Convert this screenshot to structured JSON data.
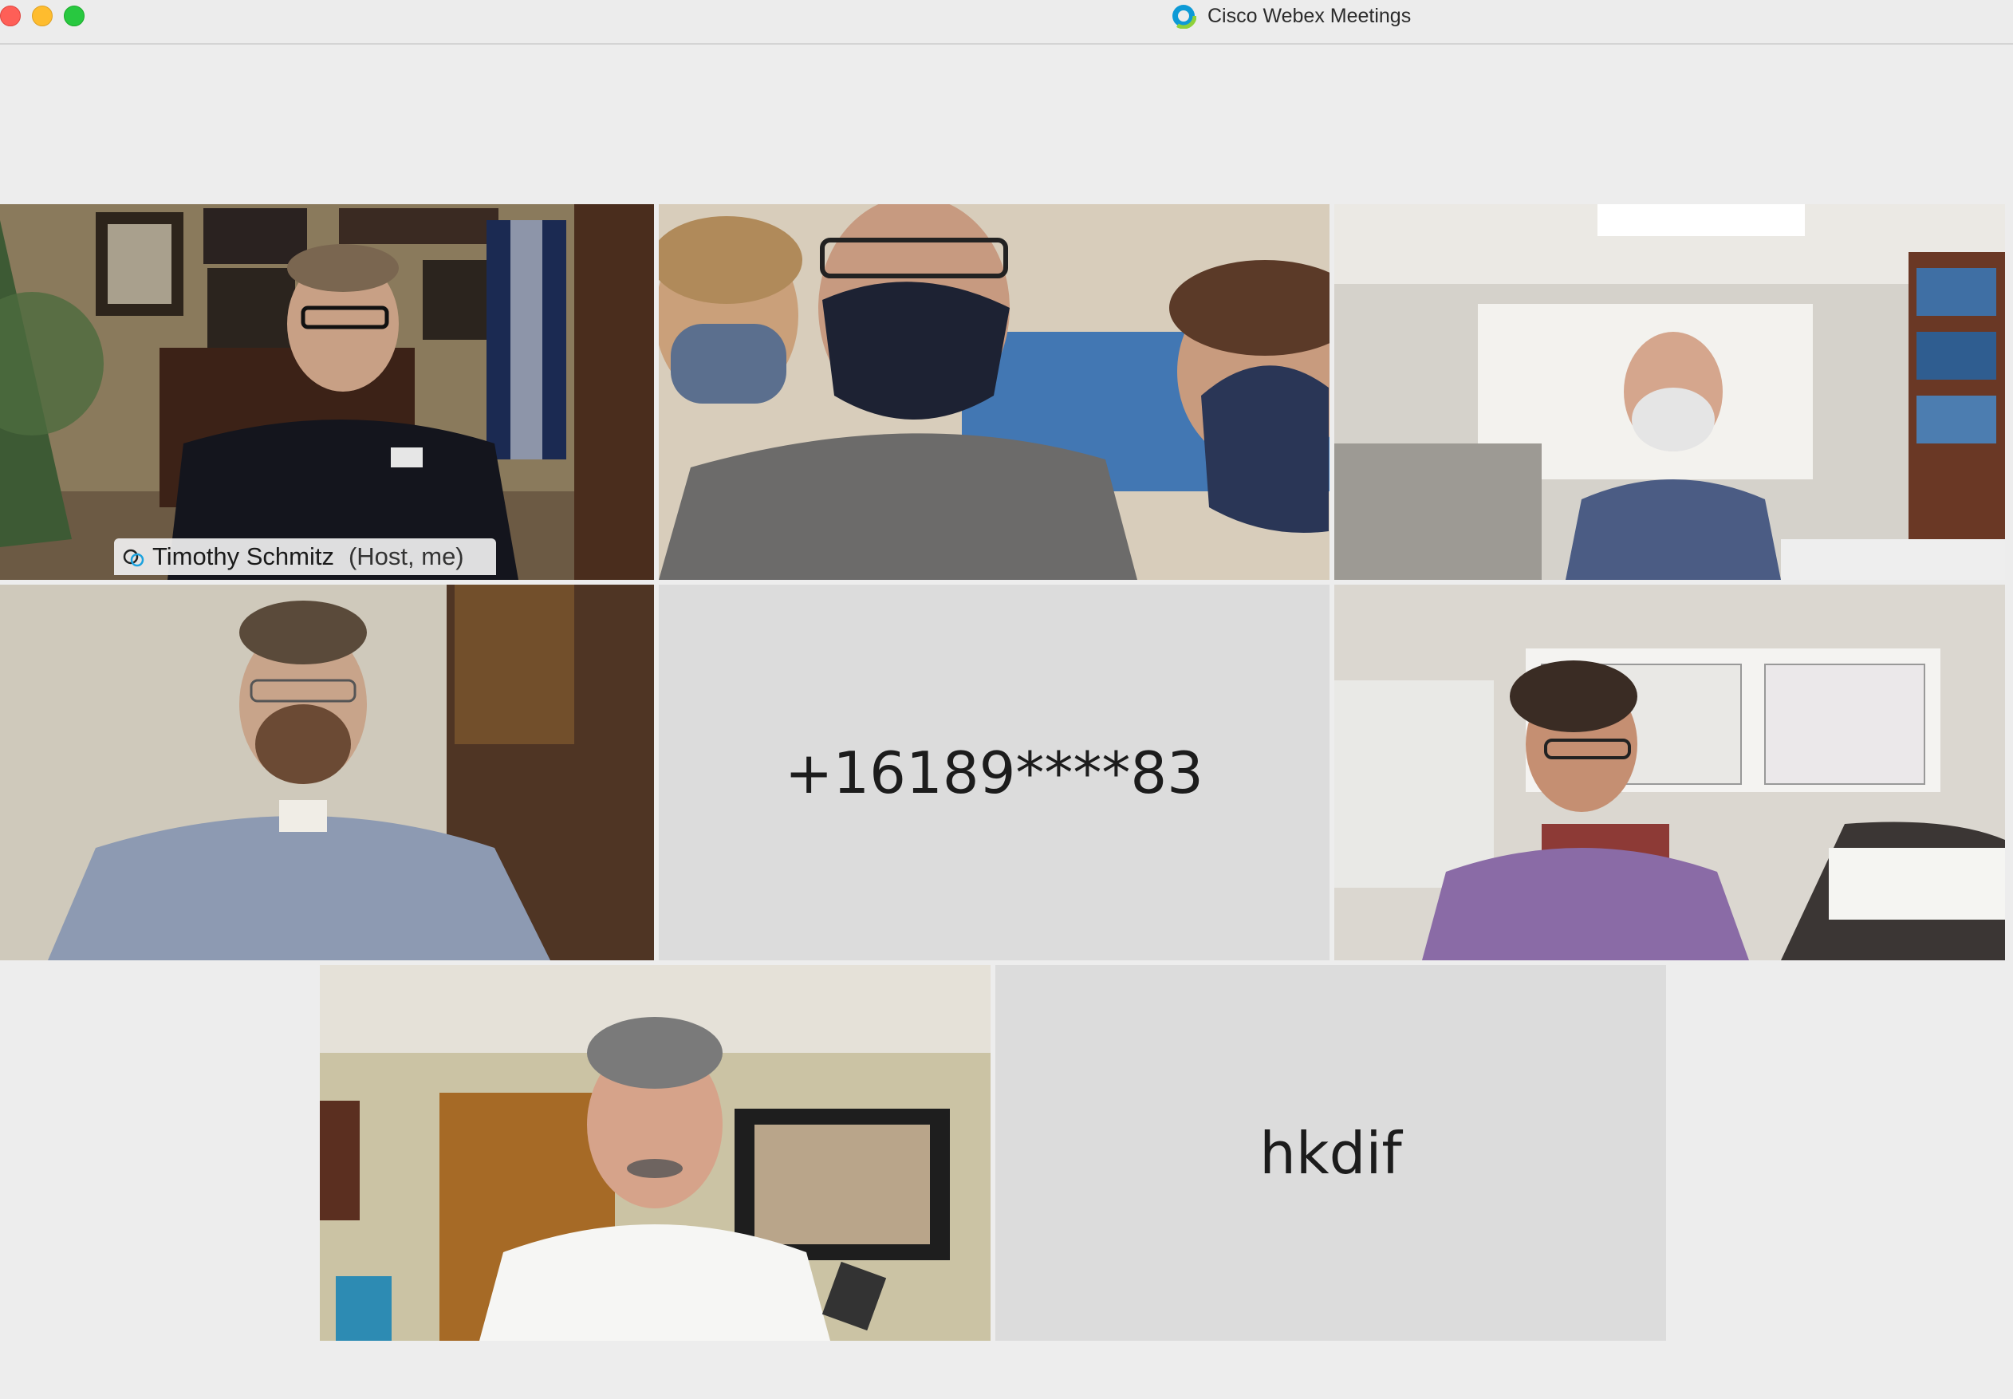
{
  "window": {
    "title": "Cisco Webex Meetings"
  },
  "host_tile": {
    "name": "Timothy Schmitz",
    "role": "(Host, me)"
  },
  "audio_tiles": [
    {
      "name": "+16189****83"
    },
    {
      "name": "hkdif"
    }
  ],
  "colors": {
    "active_speaker_border": "#1ca2de",
    "tile_background": "#dcdcdc",
    "window_background": "#ededed"
  }
}
